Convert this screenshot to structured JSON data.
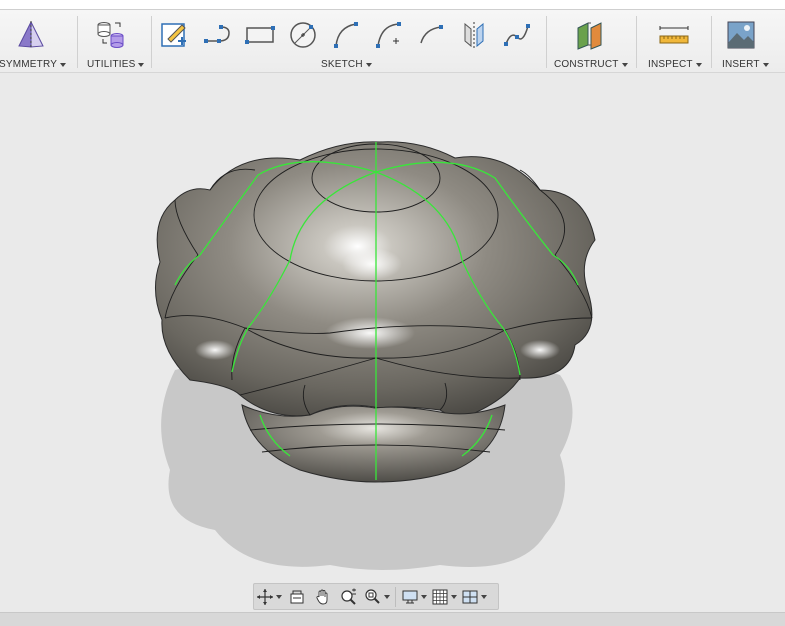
{
  "toolbar": {
    "groups": {
      "symmetry": "SYMMETRY",
      "utilities": "UTILITIES",
      "sketch": "SKETCH",
      "construct": "CONSTRUCT",
      "inspect": "INSPECT",
      "insert": "INSERT"
    }
  },
  "icons": {
    "symmetry": "symmetry-icon",
    "utilities": "convert-bodies-icon",
    "sketch": [
      "create-sketch-icon",
      "spline-line-icon",
      "rectangle-icon",
      "circle-icon",
      "arc-icon",
      "three-point-arc-icon",
      "tangent-arc-icon",
      "mirror-icon",
      "fit-spline-icon"
    ],
    "construct": "offset-plane-icon",
    "inspect": "measure-icon",
    "insert": "insert-image-icon"
  },
  "navbar": {
    "items": [
      "orbit-icon",
      "look-at-icon",
      "pan-icon",
      "zoom-icon",
      "fit-icon",
      "display-settings-icon",
      "grid-icon",
      "viewports-icon"
    ]
  },
  "colors": {
    "accent_green": "#39e63a",
    "surface": "#8c8880",
    "toolbar_bg": "#efefef",
    "viewport_bg": "#eaeaea"
  }
}
